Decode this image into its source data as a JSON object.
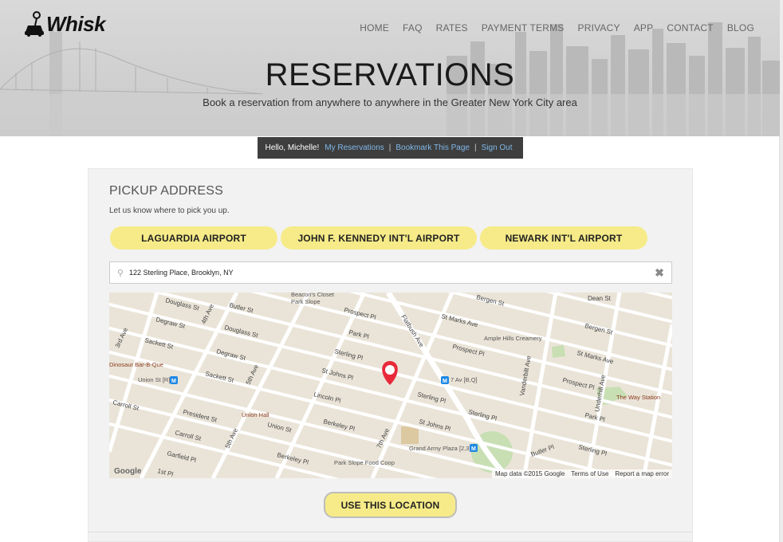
{
  "brand": {
    "name": "Whisk"
  },
  "nav": [
    "HOME",
    "FAQ",
    "RATES",
    "PAYMENT TERMS",
    "PRIVACY",
    "APP",
    "CONTACT",
    "BLOG"
  ],
  "hero": {
    "title": "RESERVATIONS",
    "subtitle": "Book a reservation from anywhere to anywhere in the Greater New York City area"
  },
  "userbar": {
    "greeting": "Hello, Michelle!",
    "links": [
      "My Reservations",
      "Bookmark This Page",
      "Sign Out"
    ]
  },
  "pickup": {
    "title": "PICKUP ADDRESS",
    "hint": "Let us know where to pick you up.",
    "airports": [
      "LAGUARDIA AIRPORT",
      "JOHN F. KENNEDY INT'L AIRPORT",
      "NEWARK INT'L AIRPORT"
    ],
    "address_value": "122 Sterling Place, Brooklyn, NY",
    "use_button": "USE THIS LOCATION"
  },
  "map": {
    "streets": [
      "Douglass St",
      "Butler St",
      "Degraw St",
      "Douglass St",
      "Sackett St",
      "Degraw St",
      "Sackett St",
      "Union St",
      "President St",
      "Carroll St",
      "Garfield Pl",
      "1st Pl",
      "Union St",
      "Berkeley Pl",
      "Lincoln Pl",
      "St Johns Pl",
      "Sterling Pl",
      "Park Pl",
      "Prospect Pl",
      "St Marks Ave",
      "Bergen St",
      "Dean St",
      "Sterling Pl",
      "Park Pl",
      "Prospect Pl",
      "St Marks Ave",
      "Bergen St",
      "Sterling Pl",
      "Park Pl",
      "St Johns Pl",
      "Sterling Pl",
      "Butler Pl",
      "4th Ave",
      "5th Ave",
      "5th Ave",
      "7th Ave",
      "Flatbush Ave",
      "Vanderbilt Ave",
      "Underhill Ave",
      "3rd Ave",
      "Union St"
    ],
    "places": [
      "Beacon's Closet Park Slope",
      "Ample Hills Creamery",
      "Dinosaur Bar-B-Que",
      "Union St [R]",
      "7 Av [B,Q]",
      "The Way Station",
      "Union Hall",
      "Grand Army Plaza [2,3]",
      "Park Slope Food Coop"
    ],
    "attribution": [
      "Map data ©2015 Google",
      "Terms of Use",
      "Report a map error"
    ],
    "logo": "Google"
  },
  "colors": {
    "accent_yellow": "#f6eb88",
    "userbar_bg": "#3e3e3e",
    "link_blue": "#7fb8e8",
    "pin_red": "#e8293a"
  }
}
